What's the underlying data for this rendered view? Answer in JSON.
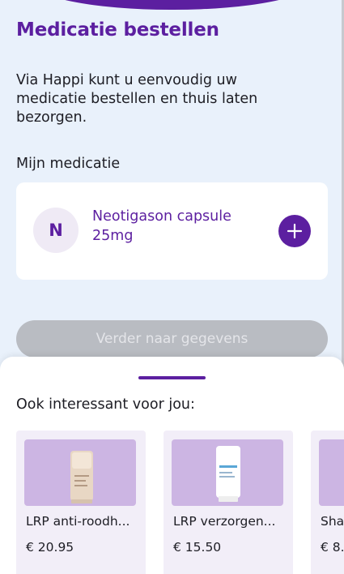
{
  "header": {
    "title": "Medicatie bestellen",
    "intro": "Via Happi kunt u eenvoudig uw medicatie bestellen en thuis laten bezorgen.",
    "accent_color": "#5c1fa0"
  },
  "medication": {
    "section_label": "Mijn medicatie",
    "items": [
      {
        "initial": "N",
        "name": "Neotigason capsule 25mg",
        "action_icon": "plus-icon"
      }
    ]
  },
  "continue_button": {
    "label": "Verder naar gegevens",
    "state": "disabled"
  },
  "recommendations": {
    "title": "Ook interessant voor jou:",
    "products": [
      {
        "name": "LRP anti-roodh...",
        "price": "€ 20.95",
        "image": "tinted-cream-tube"
      },
      {
        "name": "LRP verzorgen...",
        "price": "€ 15.50",
        "image": "white-cream-tube"
      },
      {
        "name": "Sha...",
        "price": "€ 8...",
        "image": "product-image"
      }
    ]
  }
}
